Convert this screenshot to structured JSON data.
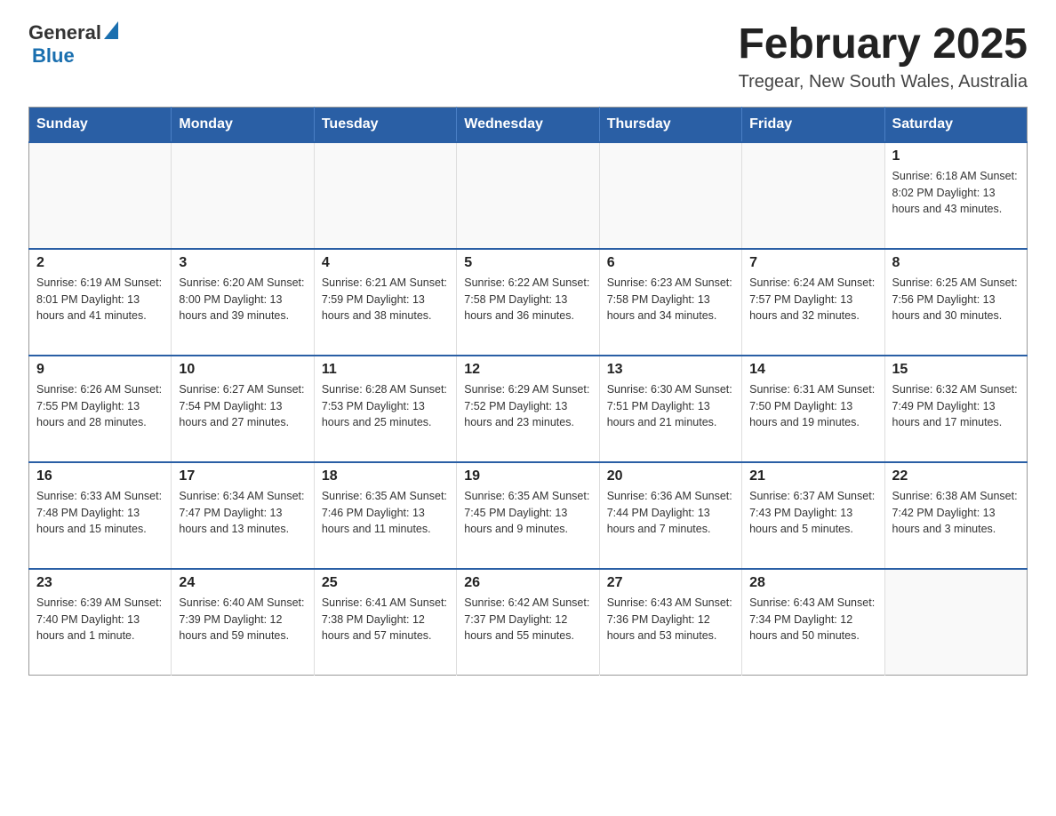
{
  "header": {
    "logo_general": "General",
    "logo_blue": "Blue",
    "title": "February 2025",
    "subtitle": "Tregear, New South Wales, Australia"
  },
  "calendar": {
    "days_of_week": [
      "Sunday",
      "Monday",
      "Tuesday",
      "Wednesday",
      "Thursday",
      "Friday",
      "Saturday"
    ],
    "weeks": [
      [
        {
          "day": "",
          "info": ""
        },
        {
          "day": "",
          "info": ""
        },
        {
          "day": "",
          "info": ""
        },
        {
          "day": "",
          "info": ""
        },
        {
          "day": "",
          "info": ""
        },
        {
          "day": "",
          "info": ""
        },
        {
          "day": "1",
          "info": "Sunrise: 6:18 AM\nSunset: 8:02 PM\nDaylight: 13 hours and 43 minutes."
        }
      ],
      [
        {
          "day": "2",
          "info": "Sunrise: 6:19 AM\nSunset: 8:01 PM\nDaylight: 13 hours and 41 minutes."
        },
        {
          "day": "3",
          "info": "Sunrise: 6:20 AM\nSunset: 8:00 PM\nDaylight: 13 hours and 39 minutes."
        },
        {
          "day": "4",
          "info": "Sunrise: 6:21 AM\nSunset: 7:59 PM\nDaylight: 13 hours and 38 minutes."
        },
        {
          "day": "5",
          "info": "Sunrise: 6:22 AM\nSunset: 7:58 PM\nDaylight: 13 hours and 36 minutes."
        },
        {
          "day": "6",
          "info": "Sunrise: 6:23 AM\nSunset: 7:58 PM\nDaylight: 13 hours and 34 minutes."
        },
        {
          "day": "7",
          "info": "Sunrise: 6:24 AM\nSunset: 7:57 PM\nDaylight: 13 hours and 32 minutes."
        },
        {
          "day": "8",
          "info": "Sunrise: 6:25 AM\nSunset: 7:56 PM\nDaylight: 13 hours and 30 minutes."
        }
      ],
      [
        {
          "day": "9",
          "info": "Sunrise: 6:26 AM\nSunset: 7:55 PM\nDaylight: 13 hours and 28 minutes."
        },
        {
          "day": "10",
          "info": "Sunrise: 6:27 AM\nSunset: 7:54 PM\nDaylight: 13 hours and 27 minutes."
        },
        {
          "day": "11",
          "info": "Sunrise: 6:28 AM\nSunset: 7:53 PM\nDaylight: 13 hours and 25 minutes."
        },
        {
          "day": "12",
          "info": "Sunrise: 6:29 AM\nSunset: 7:52 PM\nDaylight: 13 hours and 23 minutes."
        },
        {
          "day": "13",
          "info": "Sunrise: 6:30 AM\nSunset: 7:51 PM\nDaylight: 13 hours and 21 minutes."
        },
        {
          "day": "14",
          "info": "Sunrise: 6:31 AM\nSunset: 7:50 PM\nDaylight: 13 hours and 19 minutes."
        },
        {
          "day": "15",
          "info": "Sunrise: 6:32 AM\nSunset: 7:49 PM\nDaylight: 13 hours and 17 minutes."
        }
      ],
      [
        {
          "day": "16",
          "info": "Sunrise: 6:33 AM\nSunset: 7:48 PM\nDaylight: 13 hours and 15 minutes."
        },
        {
          "day": "17",
          "info": "Sunrise: 6:34 AM\nSunset: 7:47 PM\nDaylight: 13 hours and 13 minutes."
        },
        {
          "day": "18",
          "info": "Sunrise: 6:35 AM\nSunset: 7:46 PM\nDaylight: 13 hours and 11 minutes."
        },
        {
          "day": "19",
          "info": "Sunrise: 6:35 AM\nSunset: 7:45 PM\nDaylight: 13 hours and 9 minutes."
        },
        {
          "day": "20",
          "info": "Sunrise: 6:36 AM\nSunset: 7:44 PM\nDaylight: 13 hours and 7 minutes."
        },
        {
          "day": "21",
          "info": "Sunrise: 6:37 AM\nSunset: 7:43 PM\nDaylight: 13 hours and 5 minutes."
        },
        {
          "day": "22",
          "info": "Sunrise: 6:38 AM\nSunset: 7:42 PM\nDaylight: 13 hours and 3 minutes."
        }
      ],
      [
        {
          "day": "23",
          "info": "Sunrise: 6:39 AM\nSunset: 7:40 PM\nDaylight: 13 hours and 1 minute."
        },
        {
          "day": "24",
          "info": "Sunrise: 6:40 AM\nSunset: 7:39 PM\nDaylight: 12 hours and 59 minutes."
        },
        {
          "day": "25",
          "info": "Sunrise: 6:41 AM\nSunset: 7:38 PM\nDaylight: 12 hours and 57 minutes."
        },
        {
          "day": "26",
          "info": "Sunrise: 6:42 AM\nSunset: 7:37 PM\nDaylight: 12 hours and 55 minutes."
        },
        {
          "day": "27",
          "info": "Sunrise: 6:43 AM\nSunset: 7:36 PM\nDaylight: 12 hours and 53 minutes."
        },
        {
          "day": "28",
          "info": "Sunrise: 6:43 AM\nSunset: 7:34 PM\nDaylight: 12 hours and 50 minutes."
        },
        {
          "day": "",
          "info": ""
        }
      ]
    ]
  }
}
